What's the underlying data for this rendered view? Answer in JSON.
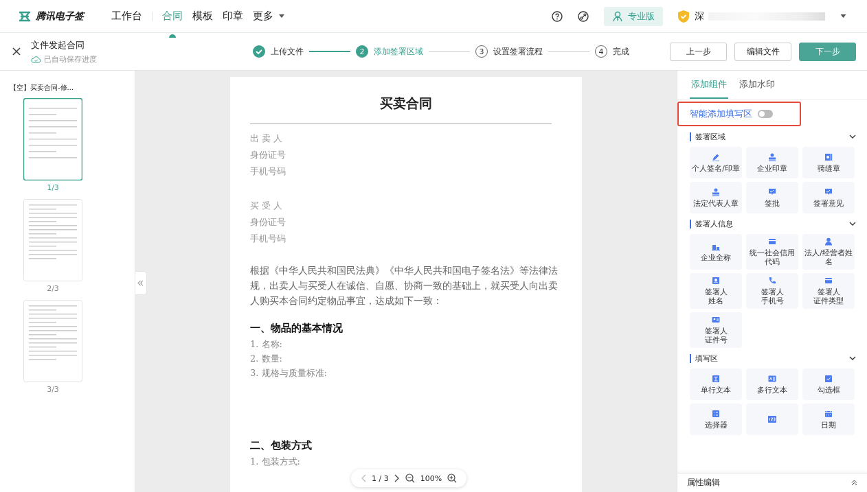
{
  "top_nav": {
    "logo": "腾讯电子签",
    "items": [
      {
        "label": "工作台",
        "selected": false,
        "kind": "link"
      },
      {
        "label": "合同",
        "selected": true,
        "kind": "link"
      },
      {
        "label": "模板",
        "selected": false,
        "kind": "link"
      },
      {
        "label": "印章",
        "selected": false,
        "kind": "link"
      },
      {
        "label": "更多",
        "selected": false,
        "kind": "dropdown"
      }
    ],
    "edition": "专业版",
    "account": "深"
  },
  "header": {
    "title": "文件发起合同",
    "save_status": "已自动保存进度",
    "steps": [
      {
        "label": "上传文件",
        "done": true,
        "selected": false
      },
      {
        "number": "2",
        "label": "添加签署区域",
        "done": false,
        "selected": true
      },
      {
        "number": "3",
        "label": "设置签署流程",
        "done": false,
        "selected": false
      },
      {
        "number": "4",
        "label": "完成",
        "done": false,
        "selected": false
      }
    ],
    "buttons": [
      {
        "label": "上一步",
        "primary": false
      },
      {
        "label": "编辑文件",
        "primary": false
      },
      {
        "label": "下一步",
        "primary": true
      }
    ]
  },
  "thumbnails": {
    "file_name": "【空】买卖合同-修...",
    "pages": [
      {
        "label": "1/3",
        "selected": true
      },
      {
        "label": "2/3",
        "selected": false
      },
      {
        "label": "3/3",
        "selected": false
      }
    ]
  },
  "document": {
    "title": "买卖合同",
    "party_groups": [
      [
        "出 卖 人",
        "身份证号",
        "手机号码"
      ],
      [
        "买 受 人",
        "身份证号",
        "手机号码"
      ]
    ],
    "intro": "根据《中华人民共和国民法典》《中华人民共和国电子签名法》等法律法规，出卖人与买受人在诚信、自愿、协商一致的基础上，就买受人向出卖人购买本合同约定物品事宜，达成如下一致：",
    "sections": [
      {
        "heading": "一、物品的基本情况",
        "items": [
          "1.  名称:",
          "2.  数量:",
          "3.  规格与质量标准:"
        ]
      },
      {
        "heading": "二、包装方式",
        "items": [
          "1.  包装方式:"
        ]
      }
    ]
  },
  "pager": {
    "page": "1 / 3",
    "zoom": "100%"
  },
  "panel": {
    "tabs": [
      {
        "label": "添加组件",
        "selected": true
      },
      {
        "label": "添加水印",
        "selected": false
      }
    ],
    "smart_fill": {
      "label": "智能添加填写区",
      "on": false
    },
    "groups": [
      {
        "title": "签署区域",
        "expanded": true,
        "items": [
          {
            "label": "个人签名/印章",
            "kind": "pen"
          },
          {
            "label": "企业印章",
            "kind": "stamp"
          },
          {
            "label": "骑缝章",
            "kind": "seal"
          },
          {
            "label": "法定代表人章",
            "kind": "stamp"
          },
          {
            "label": "签批",
            "kind": "comment"
          },
          {
            "label": "签署意见",
            "kind": "comment"
          }
        ]
      },
      {
        "title": "签署人信息",
        "expanded": true,
        "items": [
          {
            "label": "企业全称",
            "kind": "building"
          },
          {
            "label": "统一社会信用代码",
            "kind": "card"
          },
          {
            "label": "法人/经营者姓名",
            "kind": "person"
          },
          {
            "label_lines": [
              "签署人",
              "姓名"
            ],
            "kind": "badge"
          },
          {
            "label_lines": [
              "签署人",
              "手机号"
            ],
            "kind": "phone"
          },
          {
            "label_lines": [
              "签署人",
              "证件类型"
            ],
            "kind": "card"
          },
          {
            "label_lines": [
              "签署人",
              "证件号"
            ],
            "kind": "idcard"
          }
        ]
      },
      {
        "title": "填写区",
        "expanded": true,
        "items": [
          {
            "label": "单行文本",
            "kind": "text"
          },
          {
            "label": "多行文本",
            "kind": "multitext"
          },
          {
            "label": "勾选框",
            "kind": "checkbox"
          },
          {
            "label": "选择器",
            "kind": "select"
          },
          {
            "kind": "number"
          },
          {
            "label": "日期",
            "kind": "calendar"
          }
        ]
      }
    ],
    "footer": "属性编辑"
  }
}
